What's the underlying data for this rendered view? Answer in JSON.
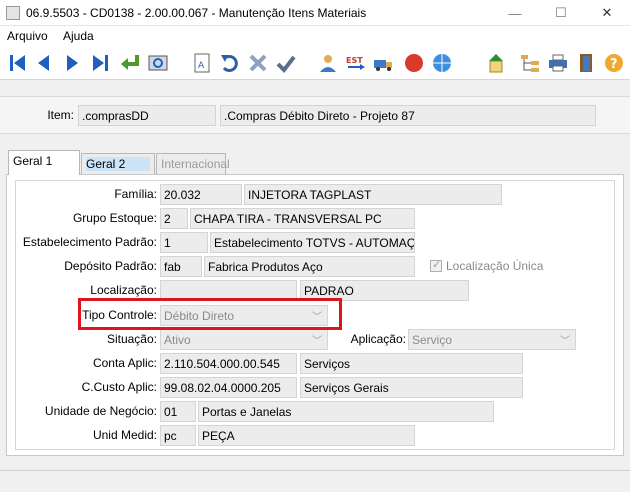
{
  "window": {
    "title": "06.9.5503 - CD0138 - 2.00.00.067 - Manutenção Itens Materiais",
    "minimize": "—",
    "maximize": "☐",
    "close": "✕"
  },
  "menu": [
    "Arquivo",
    "Ajuda"
  ],
  "toolbar": {
    "icons": [
      "first-record-icon",
      "previous-record-icon",
      "next-record-icon",
      "last-record-icon",
      "go-to-icon",
      "search-icon",
      "edit-icon",
      "undo-icon",
      "cancel-icon",
      "confirm-icon",
      "user-icon",
      "est-icon",
      "truck-icon",
      "stop-icon",
      "help-globe-icon",
      "upload-icon",
      "tree-icon",
      "print-icon",
      "exit-icon",
      "help-icon"
    ],
    "est_label": "EST"
  },
  "item": {
    "label": "Item:",
    "code": ".comprasDD",
    "description": ".Compras Débito Direto - Projeto 87"
  },
  "tabs": [
    "Geral 1",
    "Geral 2",
    "Internacional"
  ],
  "form": {
    "familia": {
      "label": "Família:",
      "code": "20.032",
      "desc": "INJETORA TAGPLAST"
    },
    "grupo_estoque": {
      "label": "Grupo Estoque:",
      "code": "2",
      "desc": "CHAPA TIRA   - TRANSVERSAL  PC"
    },
    "estabelecimento": {
      "label": "Estabelecimento Padrão:",
      "code": "1",
      "desc": "Estabelecimento TOTVS - AUTOMAÇÃO"
    },
    "deposito": {
      "label": "Depósito Padrão:",
      "code": "fab",
      "desc": "Fabrica Produtos Aço"
    },
    "localizacao_unica": {
      "label": "Localização Única",
      "checked": true
    },
    "localizacao": {
      "label": "Localização:",
      "code": "",
      "desc": "PADRAO"
    },
    "tipo_controle": {
      "label": "Tipo Controle:",
      "value": "Débito Direto"
    },
    "situacao": {
      "label": "Situação:",
      "value": "Ativo"
    },
    "aplicacao": {
      "label": "Aplicação:",
      "value": "Serviço"
    },
    "conta_aplic": {
      "label": "Conta Aplic:",
      "code": "2.110.504.000.00.545",
      "desc": "Serviços"
    },
    "ccusto_aplic": {
      "label": "C.Custo Aplic:",
      "code": "99.08.02.04.0000.205",
      "desc": "Serviços Gerais"
    },
    "unidade_negocio": {
      "label": "Unidade de Negócio:",
      "code": "01",
      "desc": "Portas e Janelas"
    },
    "unid_medid": {
      "label": "Unid Medid:",
      "code": "pc",
      "desc": "PEÇA"
    }
  },
  "colors": {
    "highlight": "#e0141e",
    "nav_blue": "#1f5fbf",
    "confirm_green": "#2f8f2f",
    "stop_red": "#d93a2b"
  }
}
